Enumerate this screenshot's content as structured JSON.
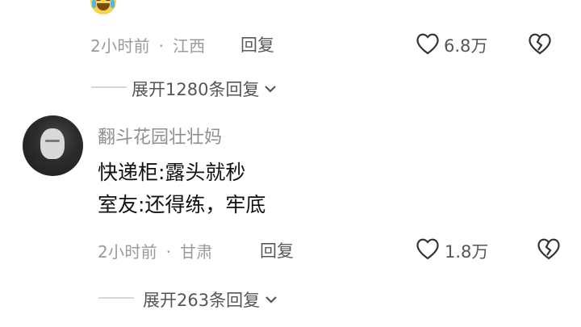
{
  "comment_top": {
    "time": "2小时前",
    "separator": "·",
    "location": "江西",
    "reply_label": "回复",
    "likes": "6.8万",
    "expand_label": "展开1280条回复"
  },
  "comment_main": {
    "username": "翻斗花园壮壮妈",
    "lines": [
      "快递柜:露头就秒",
      "室友:还得练，牢底"
    ],
    "time": "2小时前",
    "separator": "·",
    "location": "甘肃",
    "reply_label": "回复",
    "likes": "1.8万",
    "expand_label": "展开263条回复"
  },
  "icons": {
    "like": "heart-outline-icon",
    "dislike": "broken-heart-icon",
    "expand": "chevron-down-icon",
    "emoji": "laugh-cry-emoji-icon"
  }
}
